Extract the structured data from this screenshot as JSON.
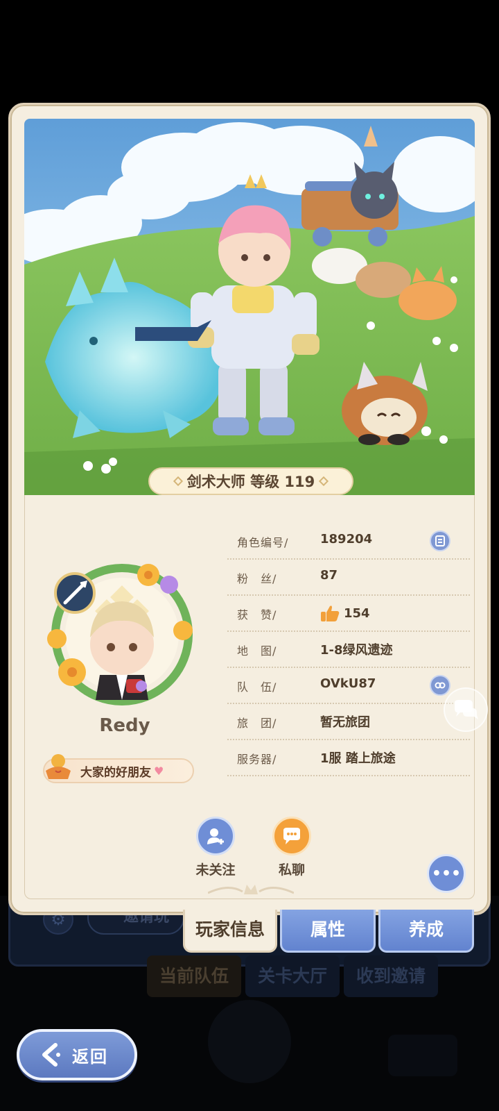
{
  "profile": {
    "class_level": "剑术大师 等级 119",
    "player_name": "Redy",
    "friend_title": "大家的好朋友"
  },
  "info": {
    "rows": [
      {
        "key": "角色编号/",
        "value": "189204"
      },
      {
        "key": "粉　丝/",
        "value": "87"
      },
      {
        "key": "获　赞/",
        "value": "154"
      },
      {
        "key": "地　图/",
        "value": "1-8绿风遗迹"
      },
      {
        "key": "队　伍/",
        "value": "OVkU87"
      },
      {
        "key": "旅　团/",
        "value": "暂无旅团"
      },
      {
        "key": "服务器/",
        "value": "1服  踏上旅途"
      }
    ]
  },
  "actions": {
    "follow_label": "未关注",
    "chat_label": "私聊"
  },
  "tabs": [
    "玩家信息",
    "属性",
    "养成"
  ],
  "background": {
    "tabs": [
      "当前队伍",
      "关卡大厅",
      "收到邀请"
    ],
    "invite_text": "邀请玩"
  },
  "back_label": "返回",
  "colors": {
    "accent_blue": "#6f8ed6",
    "accent_orange": "#f4a13a",
    "card_bg": "#f5eee0"
  }
}
